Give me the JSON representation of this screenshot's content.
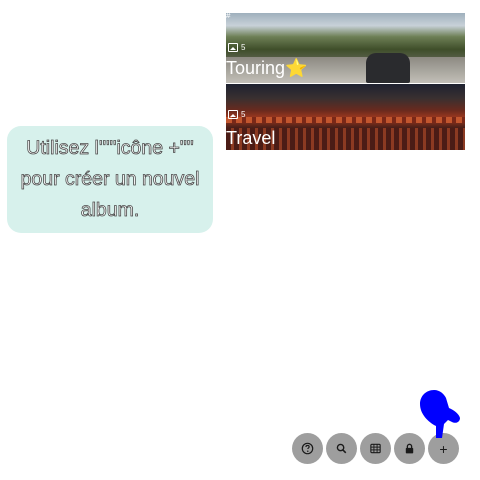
{
  "albums": [
    {
      "tag": "#",
      "count": "5",
      "title": "Touring⭐"
    },
    {
      "tag": "",
      "count": "5",
      "title": "Travel"
    }
  ],
  "hint": {
    "text": "Utilisez l'\"\"icône +\"\" pour créer un nouvel album."
  },
  "toolbar": {
    "help_icon": "question-circle-icon",
    "search_icon": "search-icon",
    "grid_icon": "grid-icon",
    "lock_icon": "lock-icon",
    "add_label": "+"
  },
  "pointer": {
    "icon": "hand-pointer-icon",
    "color": "#0000ff"
  },
  "colors": {
    "hint_bg": "#d7f1ec",
    "toolbar_button": "#9e9e9e"
  }
}
